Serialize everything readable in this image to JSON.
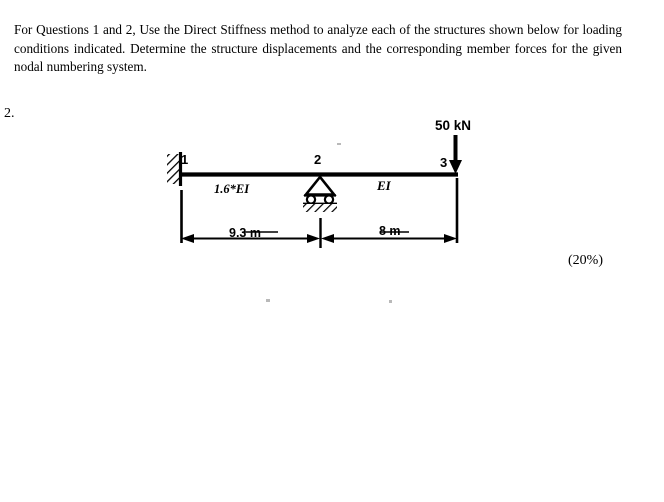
{
  "document": {
    "prompt": "For Questions 1 and 2, Use the Direct Stiffness method to analyze each of the structures shown below for loading conditions indicated. Determine the structure displacements and the corresponding member forces for the given nodal numbering system.",
    "question_number": "2.",
    "marks": "(20%)"
  },
  "diagram": {
    "type": "beam-structural-diagram",
    "nodes": [
      {
        "label": "1",
        "support": "fixed"
      },
      {
        "label": "2",
        "support": "roller"
      },
      {
        "label": "3",
        "support": "free"
      }
    ],
    "members": [
      {
        "from": "1",
        "to": "2",
        "stiffness_label": "1.6*EI",
        "length_label": "9.3 m"
      },
      {
        "from": "2",
        "to": "3",
        "stiffness_label": "EI",
        "length_label": "8 m"
      }
    ],
    "load": {
      "magnitude_label": "50 kN",
      "direction": "down",
      "at_node": "3"
    },
    "colors": {
      "ink": "#000000",
      "paper": "#ffffff"
    }
  }
}
